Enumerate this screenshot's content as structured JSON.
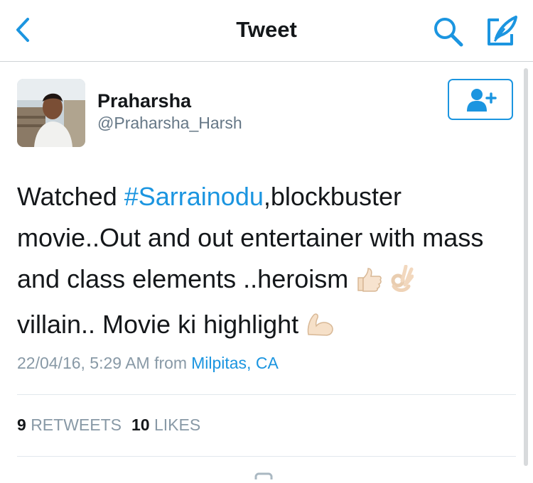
{
  "nav": {
    "title": "Tweet",
    "back_icon": "chevron-left-icon",
    "search_icon": "search-icon",
    "compose_icon": "compose-icon",
    "accent_color": "#1b95e0"
  },
  "author": {
    "display_name": "Praharsha",
    "username": "@Praharsha_Harsh",
    "avatar_icon": "avatar"
  },
  "follow_button": {
    "icon": "follow-user-icon"
  },
  "tweet": {
    "line1_before": "Watched ",
    "hashtag": "#Sarrainodu",
    "line1_after": ",blockbuster movie..Out and out entertainer with mass and class elements ..heroism ",
    "segment_villain": " villain.. Movie ki highlight ",
    "emojis": [
      "thumbs-up-emoji",
      "ok-hand-emoji",
      "flexed-biceps-emoji"
    ]
  },
  "meta": {
    "timestamp": "22/04/16, 5:29 AM",
    "from_label": "from",
    "location": "Milpitas, CA"
  },
  "stats": {
    "retweets_count": "9",
    "retweets_label": "RETWEETS",
    "likes_count": "10",
    "likes_label": "LIKES"
  }
}
